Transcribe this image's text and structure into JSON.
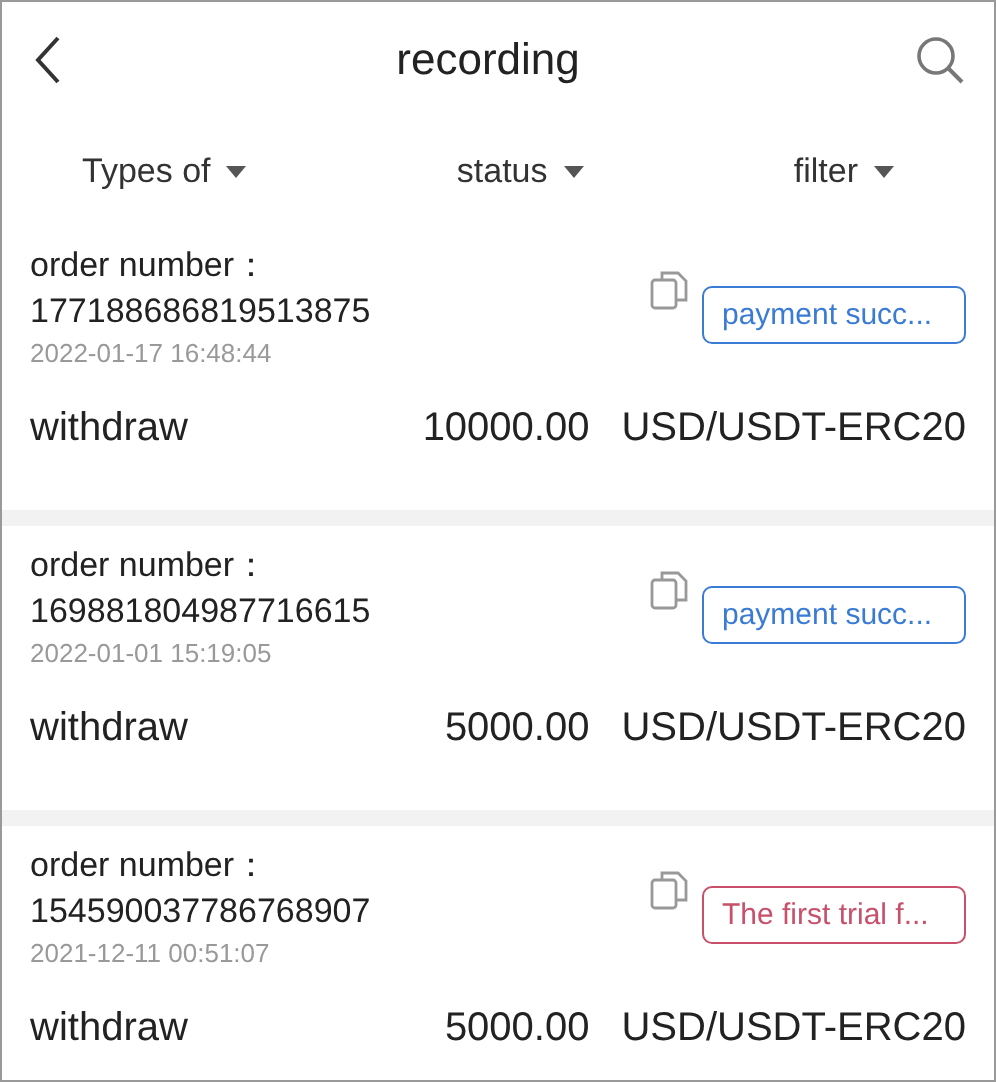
{
  "header": {
    "title": "recording"
  },
  "filters": [
    {
      "label": "Types of"
    },
    {
      "label": "status"
    },
    {
      "label": "filter"
    }
  ],
  "records": [
    {
      "order_label": "order number：",
      "order_number": "177188686819513875",
      "time": "2022-01-17 16:48:44",
      "status": "payment succ...",
      "color": "#3a7bd5",
      "type": "withdraw",
      "amount": "10000.00",
      "currency": "USD/USDT-ERC20"
    },
    {
      "order_label": "order number：",
      "order_number": "169881804987716615",
      "time": "2022-01-01 15:19:05",
      "status": "payment succ...",
      "color": "#3a7bd5",
      "type": "withdraw",
      "amount": "5000.00",
      "currency": "USD/USDT-ERC20"
    },
    {
      "order_label": "order number：",
      "order_number": "154590037786768907",
      "time": "2021-12-11 00:51:07",
      "status": "The first trial f...",
      "color": "#c8506a",
      "type": "withdraw",
      "amount": "5000.00",
      "currency": "USD/USDT-ERC20"
    }
  ]
}
